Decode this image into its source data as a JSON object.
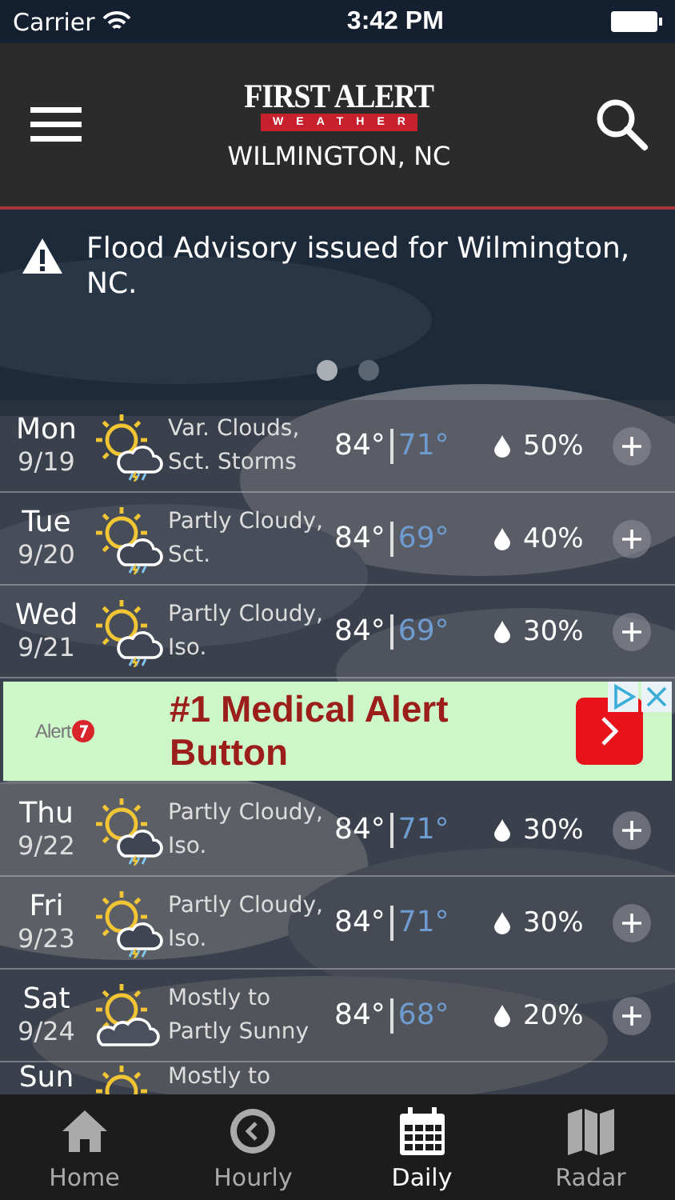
{
  "status_bar": {
    "carrier": "Carrier",
    "time": "3:42 PM"
  },
  "header": {
    "logo_top": "FIRST ALERT",
    "logo_bottom": "WEATHER",
    "location": "WILMINGTON, NC"
  },
  "alert": {
    "text": "Flood Advisory issued for Wilmington, NC.",
    "pages": [
      {
        "selected": true
      },
      {
        "selected": false
      }
    ]
  },
  "days_before_ad": [
    {
      "day": "Mon",
      "date": "9/19",
      "kind": "storm",
      "condition": "Var. Clouds, Sct. Storms",
      "high": "84°",
      "low": "71°",
      "precip": "50%"
    },
    {
      "day": "Tue",
      "date": "9/20",
      "kind": "storm",
      "condition": "Partly Cloudy, Sct.",
      "high": "84°",
      "low": "69°",
      "precip": "40%"
    },
    {
      "day": "Wed",
      "date": "9/21",
      "kind": "storm",
      "condition": "Partly Cloudy, Iso.",
      "high": "84°",
      "low": "69°",
      "precip": "30%"
    }
  ],
  "ad": {
    "brand": "Alert",
    "headline": "#1 Medical Alert Button"
  },
  "days_after_ad": [
    {
      "day": "Thu",
      "date": "9/22",
      "kind": "storm",
      "condition": "Partly Cloudy, Iso.",
      "high": "84°",
      "low": "71°",
      "precip": "30%"
    },
    {
      "day": "Fri",
      "date": "9/23",
      "kind": "storm",
      "condition": "Partly Cloudy, Iso.",
      "high": "84°",
      "low": "71°",
      "precip": "30%"
    },
    {
      "day": "Sat",
      "date": "9/24",
      "kind": "clouds",
      "condition": "Mostly to Partly Sunny",
      "high": "84°",
      "low": "68°",
      "precip": "20%"
    },
    {
      "day": "Sun",
      "kind": "clouds",
      "condition": "Mostly to"
    }
  ],
  "tabs": [
    {
      "label": "Home",
      "selected": false
    },
    {
      "label": "Hourly",
      "selected": false
    },
    {
      "label": "Daily",
      "selected": true
    },
    {
      "label": "Radar",
      "selected": false
    }
  ]
}
